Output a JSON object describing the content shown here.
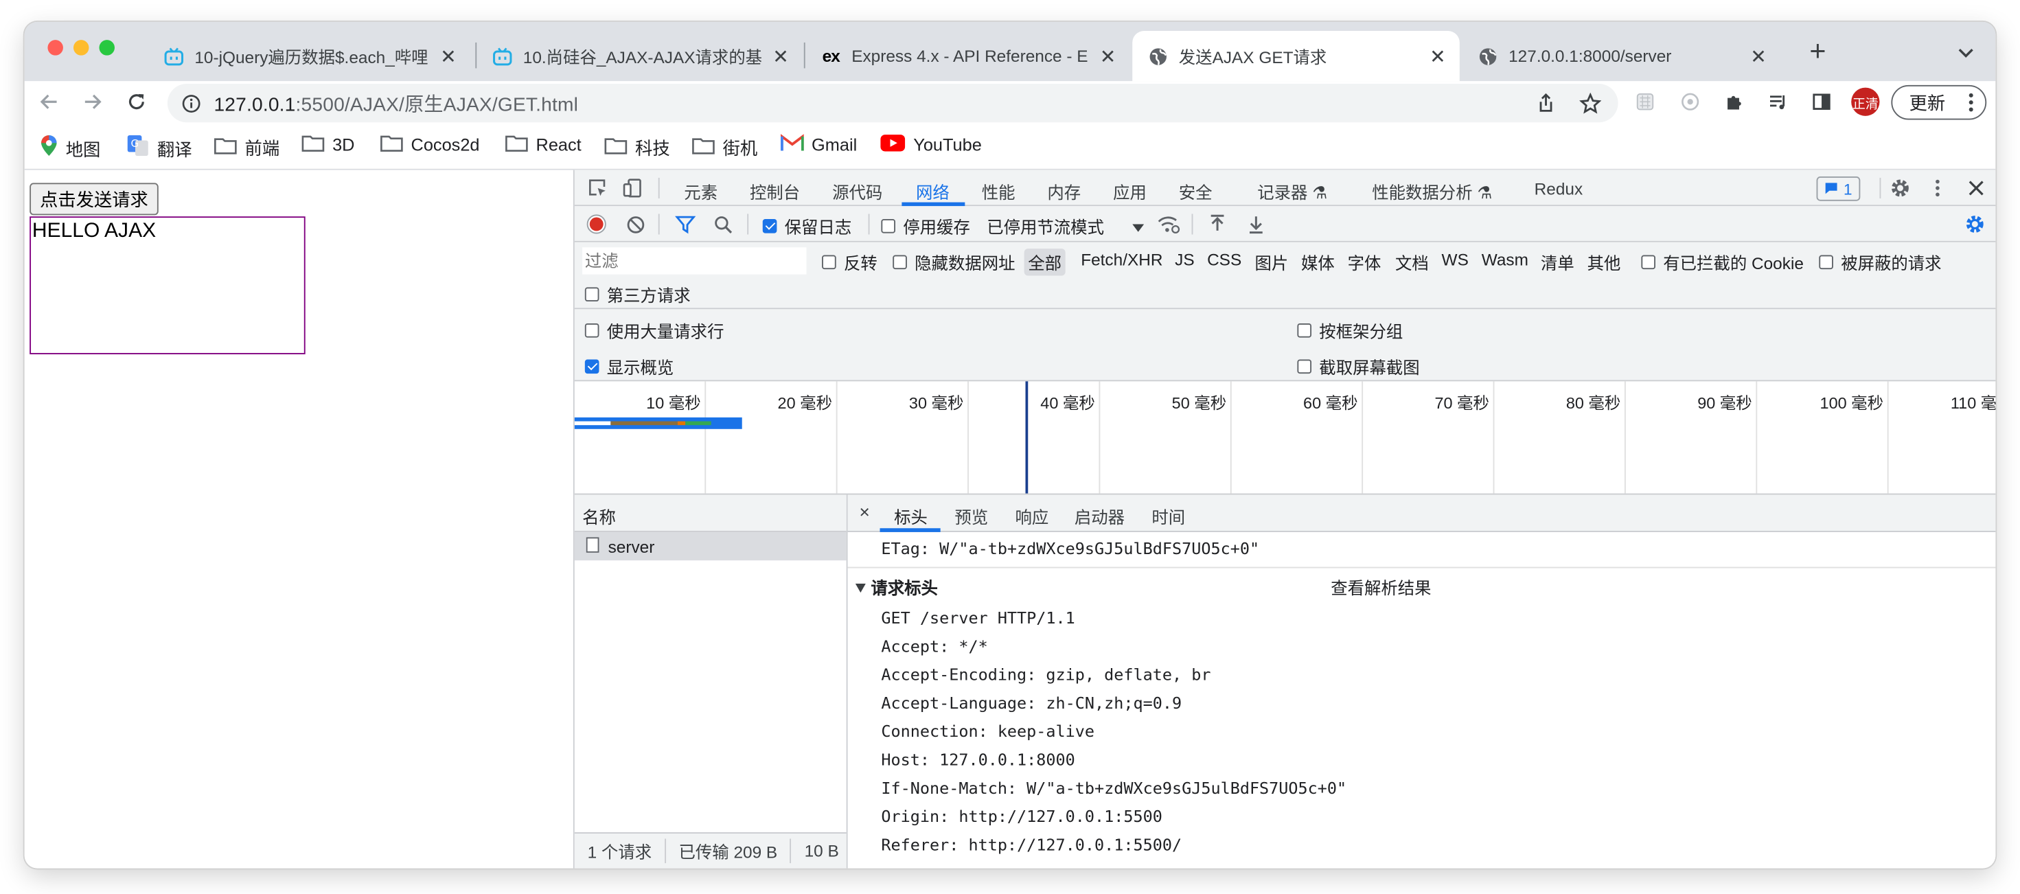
{
  "tabs": [
    {
      "icon": "bilibili-icon",
      "title": "10-jQuery遍历数据$.each_哔哩",
      "close": "✕"
    },
    {
      "icon": "bilibili-icon",
      "title": "10.尚硅谷_AJAX-AJAX请求的基",
      "close": "✕"
    },
    {
      "icon": "express-icon",
      "title": "Express 4.x - API Reference - E",
      "close": "✕"
    },
    {
      "icon": "globe-icon",
      "title": "发送AJAX GET请求",
      "close": "✕"
    },
    {
      "icon": "globe-icon",
      "title": "127.0.0.1:8000/server",
      "close": "✕"
    }
  ],
  "new_tab": "+",
  "address": {
    "host": "127.0.0.1",
    "rest": ":5500/AJAX/原生AJAX/GET.html"
  },
  "update_label": "更新",
  "profile_initials": "正清",
  "bookmarks": [
    "地图",
    "翻译",
    "前端",
    "3D",
    "Cocos2d",
    "React",
    "科技",
    "街机",
    "Gmail",
    "YouTube"
  ],
  "page": {
    "button_label": "点击发送请求",
    "result_text": "HELLO AJAX"
  },
  "devtools": {
    "panels": [
      "元素",
      "控制台",
      "源代码",
      "网络",
      "性能",
      "内存",
      "应用",
      "安全",
      "记录器 ⚗",
      "性能数据分析 ⚗",
      "Redux"
    ],
    "active_panel": "网络",
    "issues_count": "1",
    "controls": {
      "preserve_log": "保留日志",
      "disable_cache": "停用缓存",
      "throttling": "已停用节流模式"
    },
    "filter": {
      "placeholder": "过滤",
      "invert": "反转",
      "hide_data_urls": "隐藏数据网址",
      "types": [
        "全部",
        "Fetch/XHR",
        "JS",
        "CSS",
        "图片",
        "媒体",
        "字体",
        "文档",
        "WS",
        "Wasm",
        "清单",
        "其他"
      ],
      "blocked_cookies": "有已拦截的 Cookie",
      "blocked_requests": "被屏蔽的请求",
      "third_party": "第三方请求"
    },
    "options": {
      "big_rows": "使用大量请求行",
      "group_by_frame": "按框架分组",
      "show_overview": "显示概览",
      "screenshots": "截取屏幕截图"
    },
    "timeline_ticks": [
      "10 毫秒",
      "20 毫秒",
      "30 毫秒",
      "40 毫秒",
      "50 毫秒",
      "60 毫秒",
      "70 毫秒",
      "80 毫秒",
      "90 毫秒",
      "100 毫秒",
      "110 毫"
    ],
    "names_header": "名称",
    "requests": [
      "server"
    ],
    "status": {
      "count": "1 个请求",
      "transferred": "已传输 209 B",
      "size": "10 B"
    },
    "detail_tabs": [
      "标头",
      "预览",
      "响应",
      "启动器",
      "时间"
    ],
    "etag_line": "ETag: W/\"a-tb+zdWXce9sGJ5ulBdFS7UO5c+0\"",
    "request_headers_title": "请求标头",
    "view_parsed": "查看解析结果",
    "request_headers": [
      "GET /server HTTP/1.1",
      "Accept: */*",
      "Accept-Encoding: gzip, deflate, br",
      "Accept-Language: zh-CN,zh;q=0.9",
      "Connection: keep-alive",
      "Host: 127.0.0.1:8000",
      "If-None-Match: W/\"a-tb+zdWXce9sGJ5ulBdFS7UO5c+0\"",
      "Origin: http://127.0.0.1:5500",
      "Referer: http://127.0.0.1:5500/"
    ]
  },
  "colors": {
    "accent": "#1a73e8",
    "record": "#d93025",
    "result_border": "#800080"
  }
}
